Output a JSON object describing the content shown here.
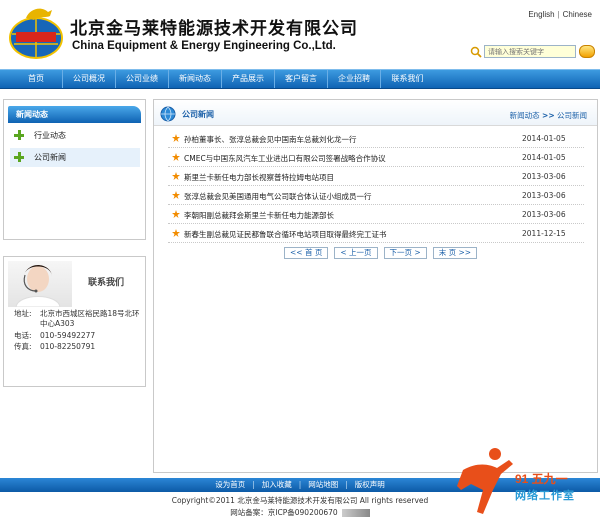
{
  "header": {
    "brand_cn": "北京金马莱特能源技术开发有限公司",
    "brand_en": "China Equipment & Energy Engineering Co.,Ltd.",
    "logo_icon": "horse-globe-logo",
    "lang_english": "English",
    "lang_sep": "|",
    "lang_chinese": "Chinese",
    "search_placeholder": "请输入搜索关键字"
  },
  "nav": {
    "items": [
      "首页",
      "公司概况",
      "公司业绩",
      "新闻动态",
      "产品展示",
      "客户留言",
      "企业招聘",
      "联系我们"
    ]
  },
  "sidebar": {
    "news_title": "新闻动态",
    "items": [
      "行业动态",
      "公司新闻"
    ],
    "contact": {
      "title": "联系我们",
      "address_label": "地址:",
      "address_line1": "北京市西城区裕民路18号北环",
      "address_line2": "中心A303",
      "phone_label": "电话:",
      "phone": "010-59492277",
      "fax_label": "传真:",
      "fax": "010-82250791"
    }
  },
  "main": {
    "title": "公司新闻",
    "crumb_parent": "新闻动态",
    "crumb_sep": ">>",
    "crumb_current": "公司新闻",
    "news": [
      {
        "title": "孙柏董事长、张淳总裁会见中国南车总裁刘化龙一行",
        "date": "2014-01-05"
      },
      {
        "title": "CMEC与中国东风汽车工业进出口有限公司签署战略合作协议",
        "date": "2014-01-05"
      },
      {
        "title": "斯里兰卡新任电力部长视察普特拉姆电站项目",
        "date": "2013-03-06"
      },
      {
        "title": "张淳总裁会见美国通用电气公司联合体认证小组成员一行",
        "date": "2013-03-06"
      },
      {
        "title": "李朝阳副总裁拜会斯里兰卡新任电力能源部长",
        "date": "2013-03-06"
      },
      {
        "title": "新春生副总裁见证民都鲁联合循环电站项目取得最终完工证书",
        "date": "2011-12-15"
      }
    ],
    "pager": [
      "<< 首 页",
      "< 上一页",
      "下一页 >",
      "末 页 >>"
    ]
  },
  "footer": {
    "links": [
      "设为首页",
      "加入收藏",
      "网站地图",
      "版权声明"
    ],
    "link_sep": "|",
    "copyright": "Copyright©2011 北京金马莱特能源技术开发有限公司 All rights reserved",
    "icp": "网站备案：京ICP备090200670",
    "watermark_num": "91 五九一",
    "watermark_text": "网络工作室"
  },
  "colors": {
    "nav_blue": "#0f63b4",
    "link_blue": "#1a5fa8",
    "accent_orange": "#f2a100",
    "plus_green": "#5aa620"
  }
}
